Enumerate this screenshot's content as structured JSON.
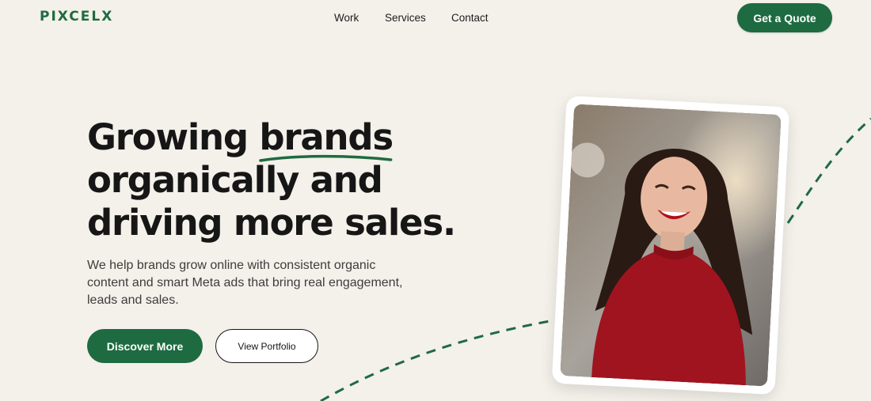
{
  "brand": {
    "logo": "PIXCELX",
    "color": "#1e6b41"
  },
  "nav": {
    "items": [
      {
        "label": "Work"
      },
      {
        "label": "Services"
      },
      {
        "label": "Contact"
      }
    ],
    "cta_label": "Get a Quote"
  },
  "hero": {
    "title_prefix": "Growing ",
    "title_accent": "brands",
    "title_line2": "organically and",
    "title_line3": "driving more sales.",
    "subtitle": "We help brands grow online with consistent organic content and smart Meta ads that bring real engagement, leads and sales.",
    "primary_button": "Discover More",
    "secondary_button": "View Portfolio",
    "image_subject": "smiling woman in red sweater"
  },
  "colors": {
    "background": "#f4f0ea",
    "accent": "#1e6b41",
    "text": "#161616"
  }
}
